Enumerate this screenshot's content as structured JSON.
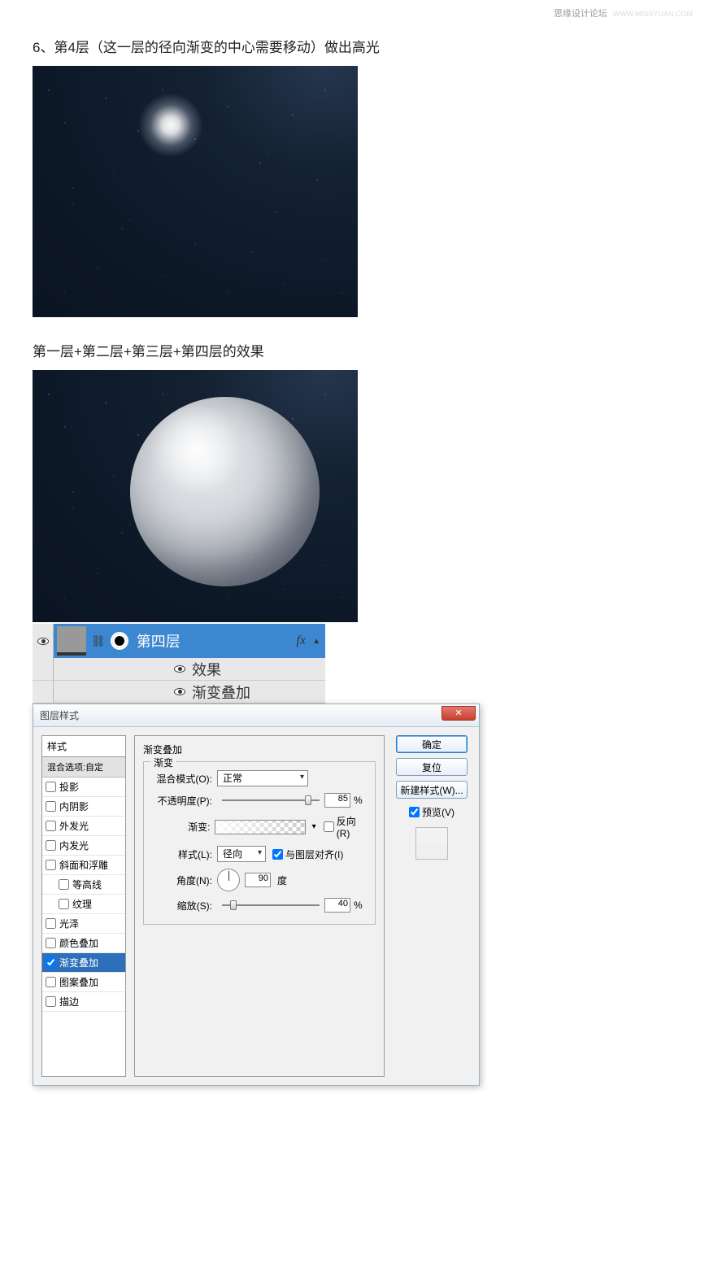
{
  "watermark": {
    "text1": "思缘设计论坛",
    "text2": "WWW.MISSYUAN.COM"
  },
  "step6": "6、第4层（这一层的径向渐变的中心需要移动）做出高光",
  "caption2": "第一层+第二层+第三层+第四层的效果",
  "layersPanel": {
    "layerName": "第四层",
    "fx": "fx",
    "effects": "效果",
    "gradOverlay": "渐变叠加"
  },
  "dialog": {
    "title": "图层样式",
    "stylesHeader": "样式",
    "blendOptions": "混合选项:自定",
    "items": [
      {
        "label": "投影",
        "checked": false,
        "indented": false
      },
      {
        "label": "内阴影",
        "checked": false,
        "indented": false
      },
      {
        "label": "外发光",
        "checked": false,
        "indented": false
      },
      {
        "label": "内发光",
        "checked": false,
        "indented": false
      },
      {
        "label": "斜面和浮雕",
        "checked": false,
        "indented": false
      },
      {
        "label": "等高线",
        "checked": false,
        "indented": true
      },
      {
        "label": "纹理",
        "checked": false,
        "indented": true
      },
      {
        "label": "光泽",
        "checked": false,
        "indented": false
      },
      {
        "label": "颜色叠加",
        "checked": false,
        "indented": false
      },
      {
        "label": "渐变叠加",
        "checked": true,
        "indented": false,
        "selected": true
      },
      {
        "label": "图案叠加",
        "checked": false,
        "indented": false
      },
      {
        "label": "描边",
        "checked": false,
        "indented": false
      }
    ],
    "groupTitle": "渐变叠加",
    "fieldsetLegend": "渐变",
    "labels": {
      "blendMode": "混合模式(O):",
      "opacity": "不透明度(P):",
      "gradient": "渐变:",
      "reverse": "反向(R)",
      "style": "样式(L):",
      "alignWithLayer": "与图层对齐(I)",
      "angle": "角度(N):",
      "degree": "度",
      "scale": "缩放(S):"
    },
    "values": {
      "blendMode": "正常",
      "opacity": "85",
      "style": "径向",
      "angle": "90",
      "scale": "40",
      "alignChecked": true,
      "reverseChecked": false
    },
    "buttons": {
      "ok": "确定",
      "reset": "复位",
      "newStyle": "新建样式(W)...",
      "preview": "预览(V)"
    }
  }
}
